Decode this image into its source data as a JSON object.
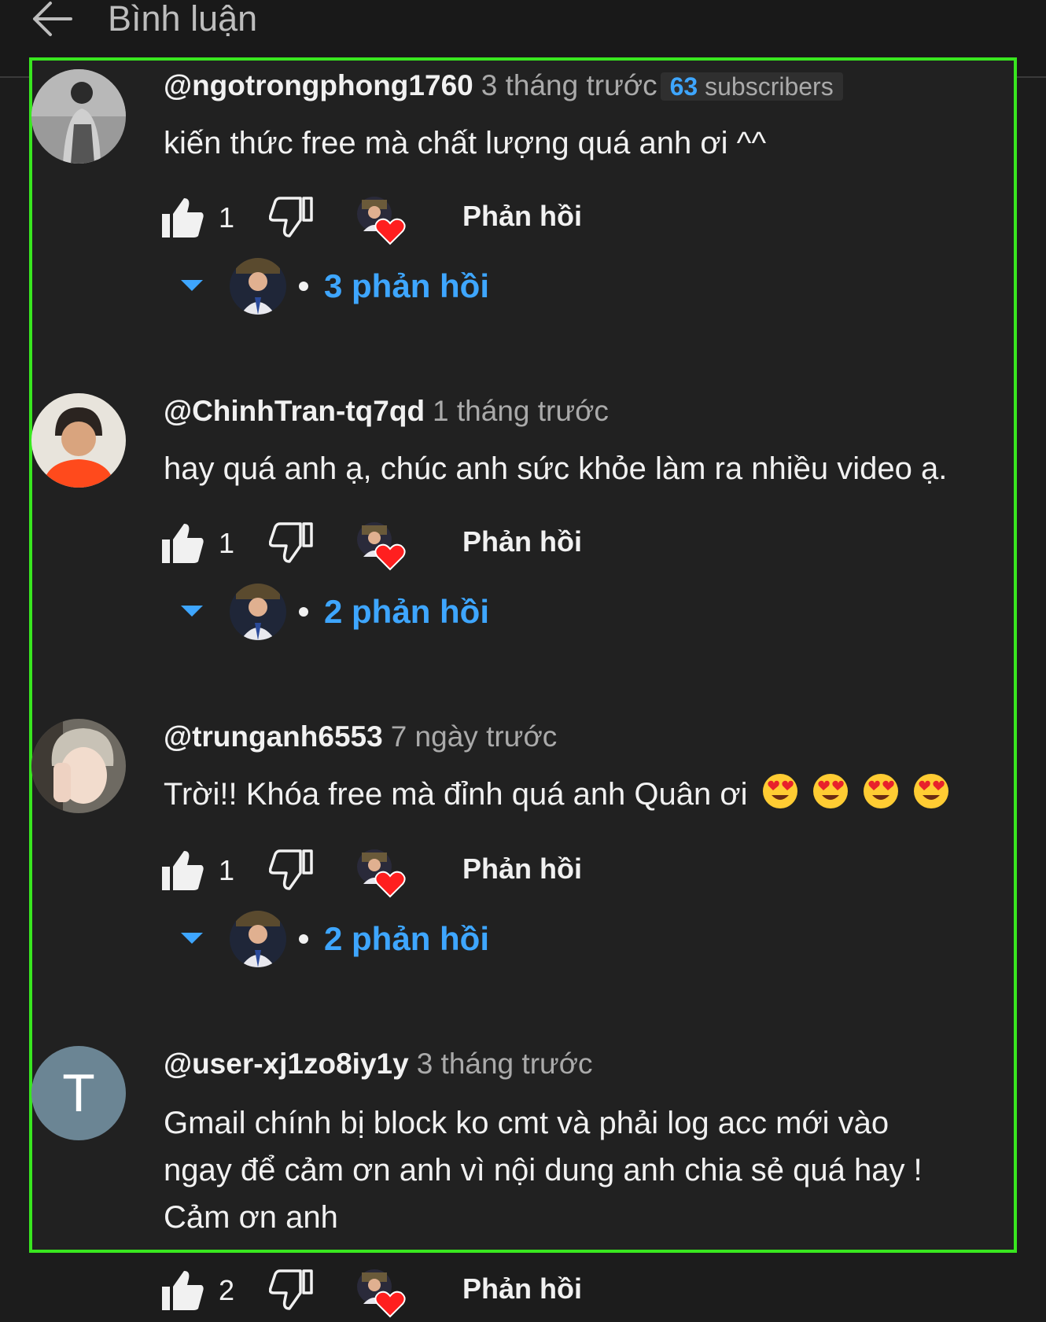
{
  "header": {
    "title": "Bình luận"
  },
  "colors": {
    "accent": "#3ea6ff",
    "highlight_border": "#39e61f",
    "background": "#212121"
  },
  "comments": [
    {
      "handle": "@ngotrongphong1760",
      "time": "3 tháng trước",
      "badge_count": "63",
      "badge_label": "subscribers",
      "text": "kiến thức free mà chất lượng quá anh ơi ^^",
      "likes": "1",
      "reply_label": "Phản hồi",
      "replies_count": "3 phản hồi"
    },
    {
      "handle": "@ChinhTran-tq7qd",
      "time": "1 tháng trước",
      "text": "hay quá anh ạ, chúc anh sức khỏe làm ra nhiều video ạ.",
      "likes": "1",
      "reply_label": "Phản hồi",
      "replies_count": "2 phản hồi"
    },
    {
      "handle": "@trunganh6553",
      "time": "7 ngày trước",
      "text": "Trời!! Khóa free mà đỉnh quá anh Quân ơi",
      "likes": "1",
      "reply_label": "Phản hồi",
      "replies_count": "2 phản hồi"
    },
    {
      "handle": "@user-xj1zo8iy1y",
      "avatar_letter": "T",
      "time": "3 tháng trước",
      "text_lines": [
        "Gmail chính bị block ko cmt và phải log acc mới vào",
        "ngay để cảm ơn anh vì nội dung anh chia sẻ quá hay !",
        "Cảm ơn anh"
      ],
      "likes": "2",
      "reply_label": "Phản hồi"
    }
  ]
}
